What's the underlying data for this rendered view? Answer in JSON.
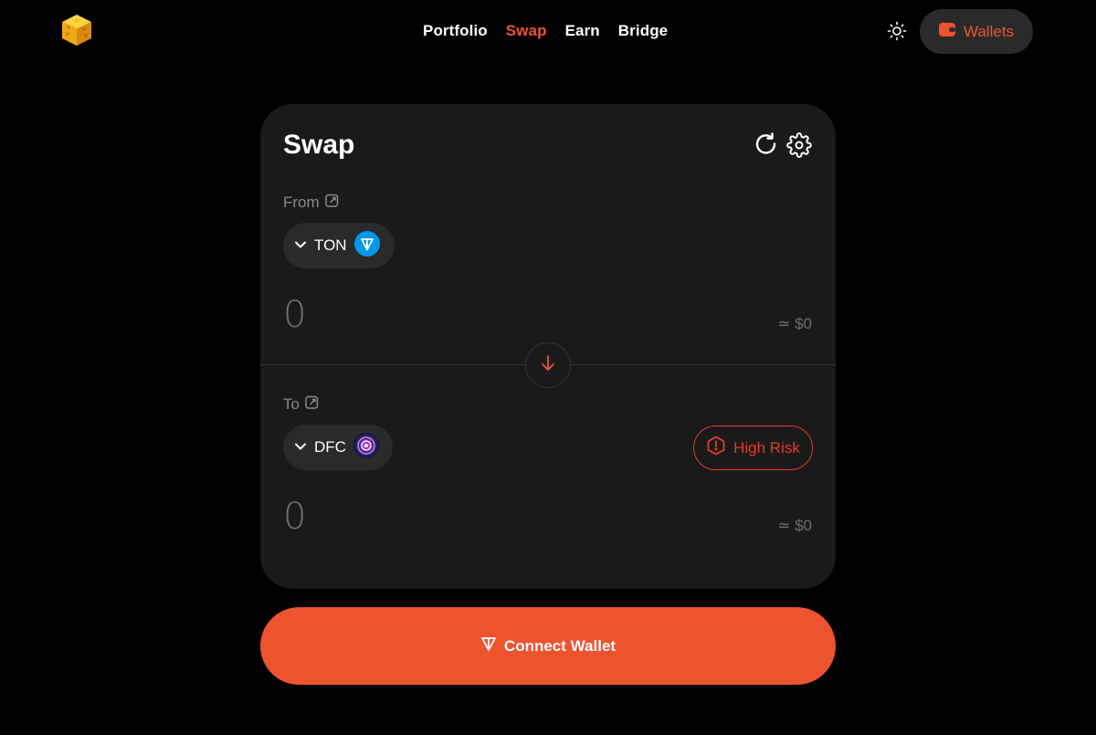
{
  "nav": {
    "items": [
      {
        "label": "Portfolio",
        "active": false
      },
      {
        "label": "Swap",
        "active": true
      },
      {
        "label": "Earn",
        "active": false
      },
      {
        "label": "Bridge",
        "active": false
      }
    ]
  },
  "header": {
    "wallets_label": "Wallets"
  },
  "swap": {
    "title": "Swap",
    "from": {
      "label": "From",
      "token": "TON",
      "amount": "0",
      "usd": "≃ $0"
    },
    "to": {
      "label": "To",
      "token": "DFC",
      "amount": "0",
      "usd": "≃ $0",
      "risk_label": "High Risk"
    },
    "connect_label": "Connect Wallet"
  },
  "icons": {
    "logo": "cube-logo-icon",
    "theme": "sun-icon",
    "wallet": "wallet-icon",
    "refresh": "refresh-icon",
    "settings": "gear-icon",
    "external": "external-link-icon",
    "chevron": "chevron-down-icon",
    "swap_direction": "arrow-down-icon",
    "risk": "warning-hexagon-icon",
    "ton": "ton-icon"
  },
  "colors": {
    "accent": "#ee5330",
    "danger": "#e23b33",
    "card": "#1a1a1a",
    "background": "#000000",
    "ton_blue": "#0098ea"
  }
}
